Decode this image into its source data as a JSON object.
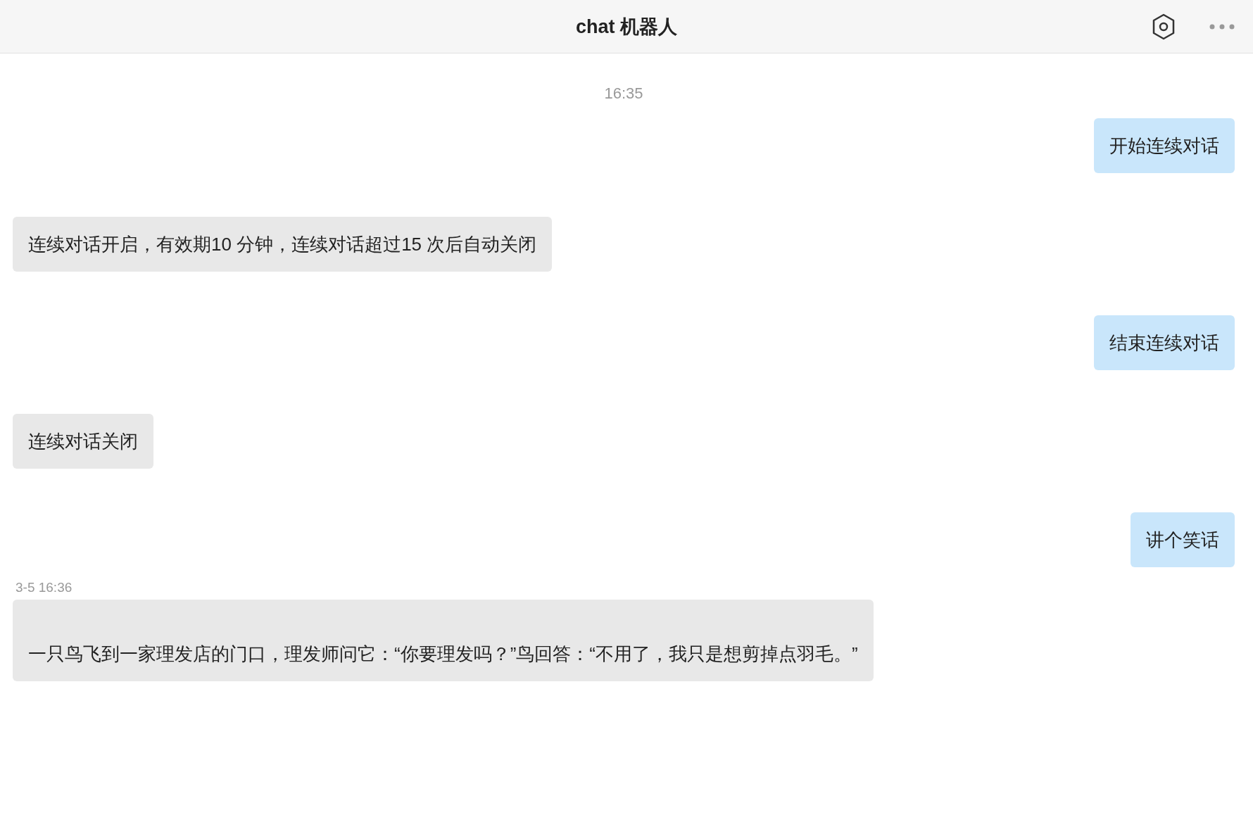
{
  "header": {
    "title": "chat 机器人"
  },
  "messages": [
    {
      "kind": "time",
      "text": "16:35"
    },
    {
      "kind": "user",
      "text": "开始连续对话"
    },
    {
      "kind": "bot",
      "text": "连续对话开启，有效期10 分钟，连续对话超过15 次后自动关闭"
    },
    {
      "kind": "user",
      "text": "结束连续对话"
    },
    {
      "kind": "bot",
      "text": "连续对话关闭"
    },
    {
      "kind": "user",
      "text": "讲个笑话"
    },
    {
      "kind": "bot",
      "timestamp": "3-5 16:36",
      "text": "一只鸟飞到一家理发店的门口，理发师问它：“你要理发吗？”鸟回答：“不用了，我只是想剪掉点羽毛。”",
      "lead_blank": true
    }
  ]
}
